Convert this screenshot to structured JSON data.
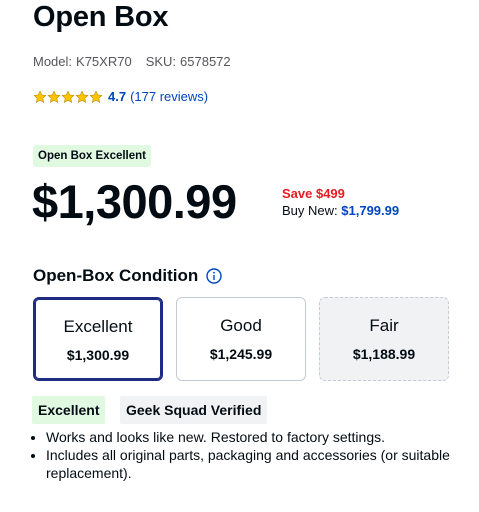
{
  "product": {
    "title": "Open Box",
    "model_label": "Model:",
    "model_value": "K75XR70",
    "sku_label": "SKU:",
    "sku_value": "6578572"
  },
  "rating": {
    "score": "4.7",
    "reviews": "(177 reviews)",
    "stars": 5,
    "star_color": "#ffc500"
  },
  "pricing": {
    "condition_badge": "Open Box Excellent",
    "price": "$1,300.99",
    "save": "Save $499",
    "buy_new_label": "Buy New:",
    "buy_new_value": "$1,799.99",
    "save_color": "#e81b23",
    "link_color": "#0046be"
  },
  "condition": {
    "heading": "Open-Box Condition",
    "options": [
      {
        "name": "Excellent",
        "price": "$1,300.99",
        "selected": true
      },
      {
        "name": "Good",
        "price": "$1,245.99",
        "selected": false
      },
      {
        "name": "Fair",
        "price": "$1,188.99",
        "selected": false
      }
    ]
  },
  "details": {
    "tags": [
      "Excellent",
      "Geek Squad Verified"
    ],
    "bullets": [
      "Works and looks like new. Restored to factory settings.",
      "Includes all original parts, packaging and accessories (or suitable replacement)."
    ]
  }
}
